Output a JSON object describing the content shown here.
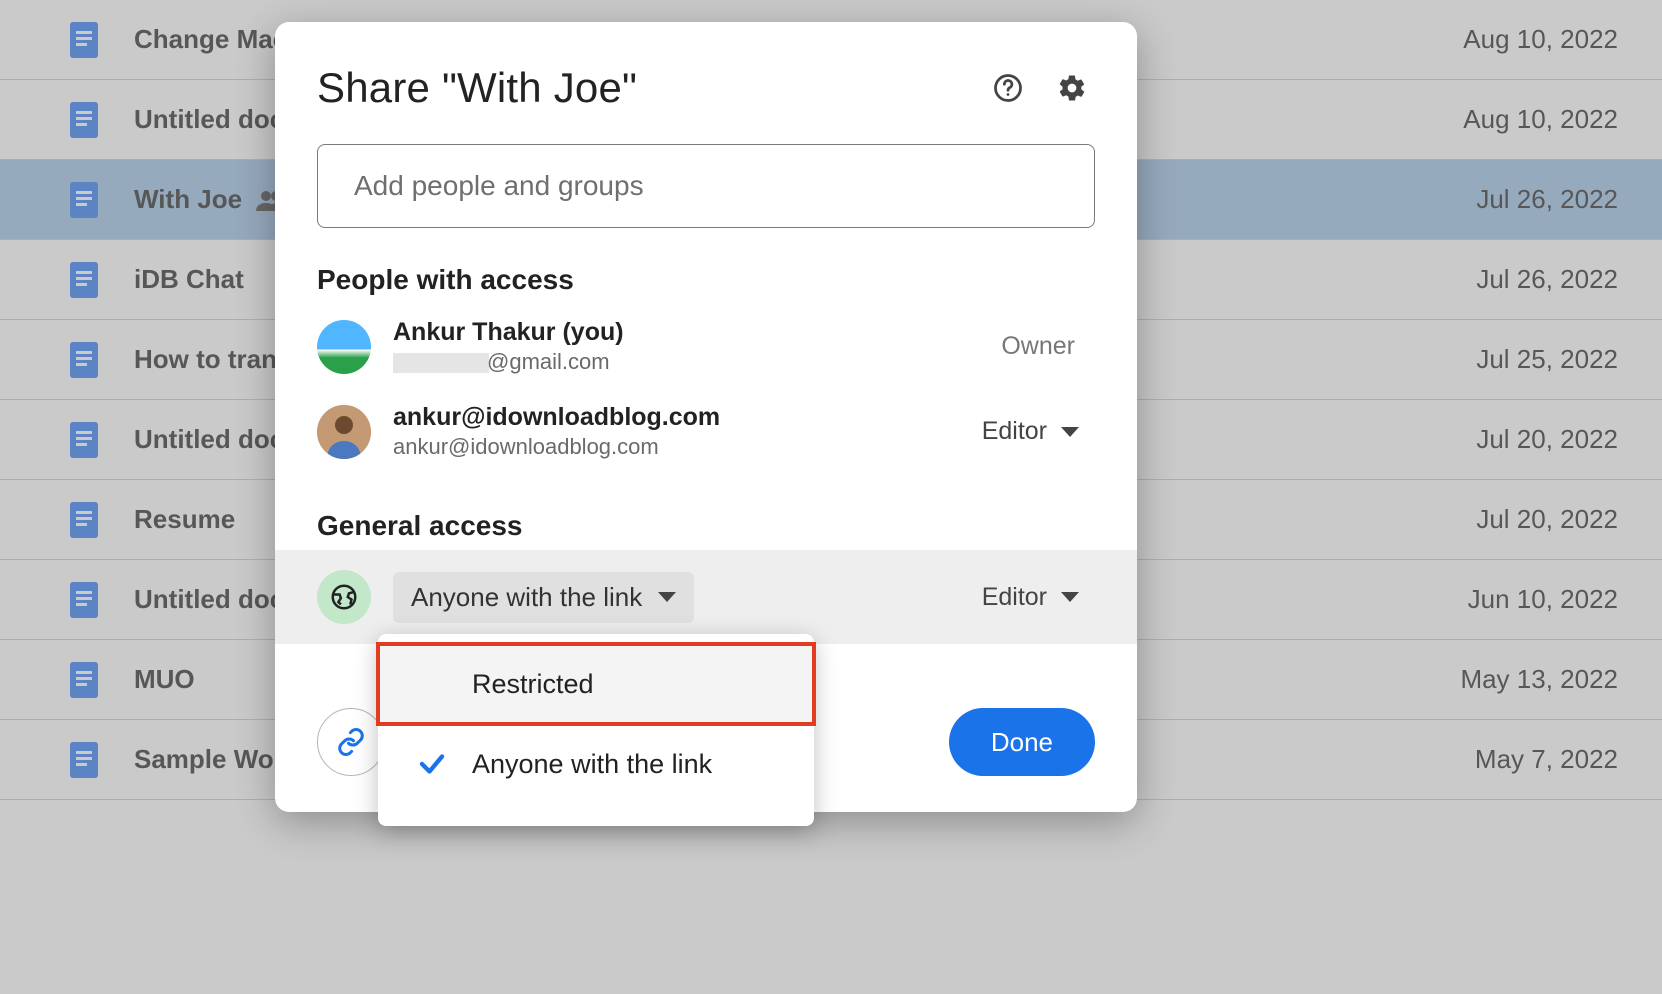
{
  "files": [
    {
      "name": "Change Mac",
      "date": "Aug 10, 2022",
      "selected": false,
      "shared": false
    },
    {
      "name": "Untitled docu",
      "date": "Aug 10, 2022",
      "selected": false,
      "shared": false
    },
    {
      "name": "With Joe",
      "date": "Jul 26, 2022",
      "selected": true,
      "shared": true
    },
    {
      "name": "iDB Chat",
      "date": "Jul 26, 2022",
      "selected": false,
      "shared": false
    },
    {
      "name": "How to trans",
      "date": "Jul 25, 2022",
      "selected": false,
      "shared": false
    },
    {
      "name": "Untitled docu",
      "date": "Jul 20, 2022",
      "selected": false,
      "shared": false
    },
    {
      "name": "Resume",
      "date": "Jul 20, 2022",
      "selected": false,
      "shared": false
    },
    {
      "name": "Untitled docu",
      "date": "Jun 10, 2022",
      "selected": false,
      "shared": false
    },
    {
      "name": "MUO",
      "date": "May 13, 2022",
      "selected": false,
      "shared": false
    },
    {
      "name": "Sample Worc",
      "date": "May 7, 2022",
      "selected": false,
      "shared": false
    }
  ],
  "dialog": {
    "title": "Share \"With Joe\"",
    "input_placeholder": "Add people and groups",
    "people_heading": "People with access",
    "owner": {
      "name": "Ankur Thakur (you)",
      "email_suffix": "@gmail.com",
      "role": "Owner"
    },
    "editor": {
      "name": "ankur@idownloadblog.com",
      "email": "ankur@idownloadblog.com",
      "role": "Editor"
    },
    "general_heading": "General access",
    "general_current": "Anyone with the link",
    "general_role": "Editor",
    "dropdown": {
      "option_restricted": "Restricted",
      "option_anyone": "Anyone with the link"
    },
    "done": "Done"
  }
}
